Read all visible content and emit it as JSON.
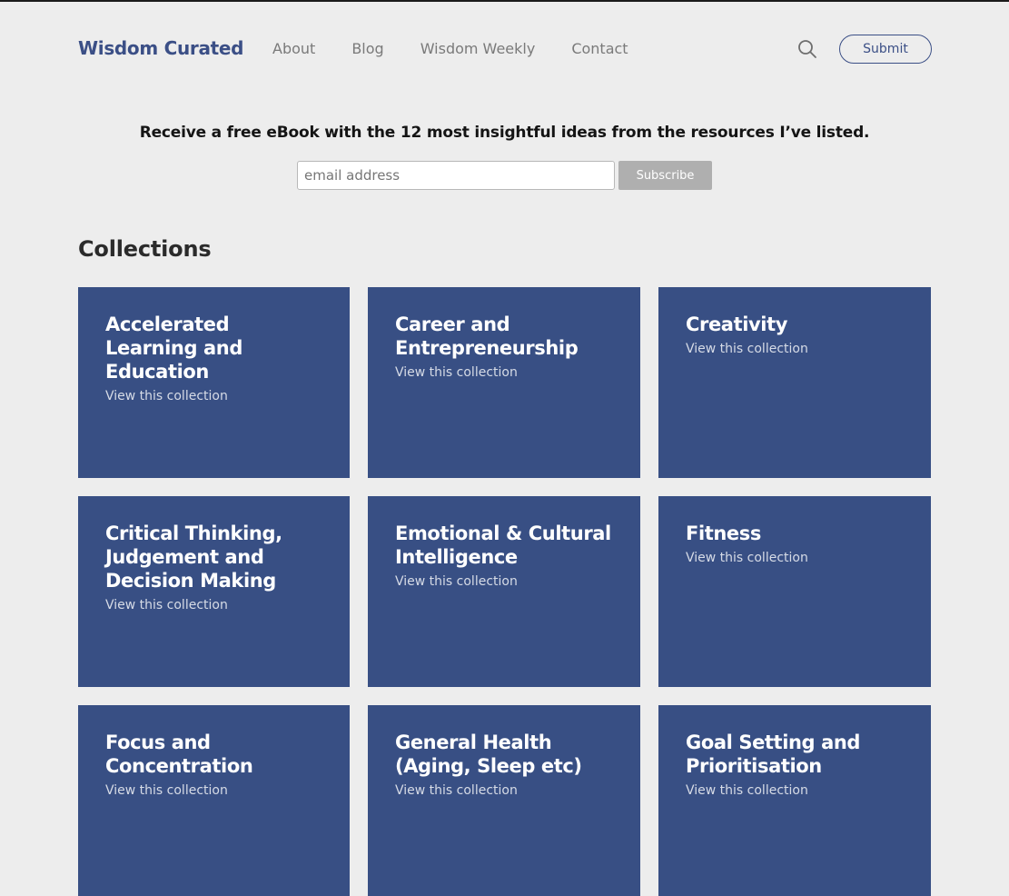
{
  "header": {
    "brand": "Wisdom Curated",
    "nav": [
      "About",
      "Blog",
      "Wisdom Weekly",
      "Contact"
    ],
    "search_icon": "search-icon",
    "submit_label": "Submit"
  },
  "promo": {
    "text": "Receive a free eBook with the 12 most insightful ideas from the resources I’ve listed.",
    "email_placeholder": "email address",
    "email_value": "",
    "subscribe_label": "Subscribe"
  },
  "collections": {
    "title": "Collections",
    "items": [
      {
        "title": "Accelerated\nLearning and\nEducation",
        "link": "View this collection"
      },
      {
        "title": "Career and\nEntrepreneurship",
        "link": "View this collection"
      },
      {
        "title": "Creativity",
        "link": "View this collection"
      },
      {
        "title": "Critical Thinking,\nJudgement and\nDecision Making",
        "link": "View this collection"
      },
      {
        "title": "Emotional & Cultural\nIntelligence",
        "link": "View this collection"
      },
      {
        "title": "Fitness",
        "link": "View this collection"
      },
      {
        "title": "Focus and\nConcentration",
        "link": "View this collection"
      },
      {
        "title": "General Health\n(Aging, Sleep etc)",
        "link": "View this collection"
      },
      {
        "title": "Goal Setting and\nPrioritisation",
        "link": "View this collection"
      }
    ]
  },
  "colors": {
    "brand": "#3b4f86",
    "card": "#384f84",
    "background": "#ededed"
  }
}
